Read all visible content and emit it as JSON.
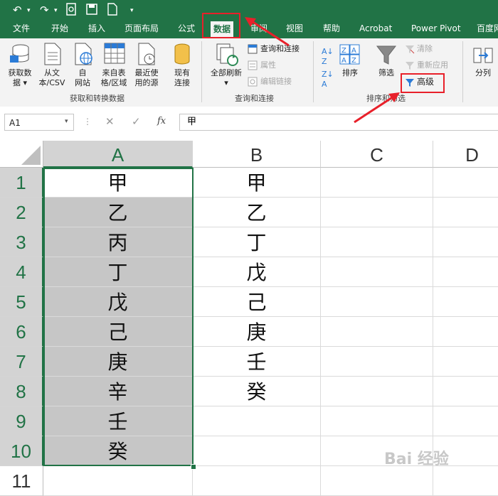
{
  "tabs": [
    "文件",
    "开始",
    "插入",
    "页面布局",
    "公式",
    "数据",
    "审阅",
    "视图",
    "帮助",
    "Acrobat",
    "Power Pivot",
    "百度网"
  ],
  "ribbon": {
    "get_data": "获取数\n据",
    "from_csv": "从文\n本/CSV",
    "from_web": "自\n网站",
    "from_table": "来自表\n格/区域",
    "recent_sources": "最近使\n用的源",
    "existing_conn": "现有\n连接",
    "group1_label": "获取和转换数据",
    "refresh_all": "全部刷新",
    "queries_conn": "查询和连接",
    "properties": "属性",
    "edit_links": "编辑链接",
    "group2_label": "查询和连接",
    "sort": "排序",
    "filter": "筛选",
    "clear": "清除",
    "reapply": "重新应用",
    "advanced": "高级",
    "group3_label": "排序和筛选",
    "split": "分列"
  },
  "formula_bar": {
    "name_box": "A1",
    "value": "甲",
    "fx": "fx"
  },
  "columns": [
    "A",
    "B",
    "C",
    "D"
  ],
  "rows": [
    "1",
    "2",
    "3",
    "4",
    "5",
    "6",
    "7",
    "8",
    "9",
    "10",
    "11"
  ],
  "colA": [
    "甲",
    "乙",
    "丙",
    "丁",
    "戊",
    "己",
    "庚",
    "辛",
    "壬",
    "癸",
    ""
  ],
  "colB": [
    "甲",
    "乙",
    "丁",
    "戊",
    "己",
    "庚",
    "壬",
    "癸",
    "",
    "",
    ""
  ],
  "watermark": "Bai 经验"
}
